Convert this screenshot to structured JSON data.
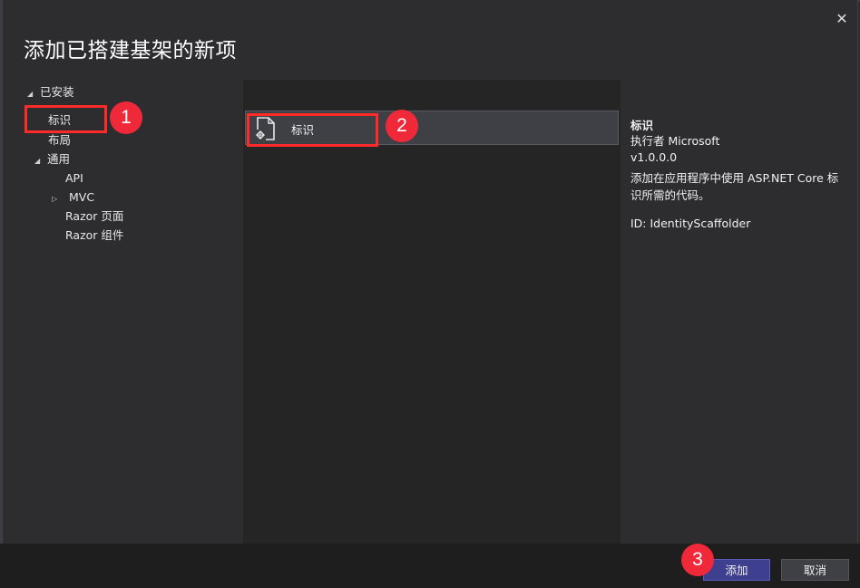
{
  "dialog": {
    "title": "添加已搭建基架的新项",
    "close_glyph": "✕"
  },
  "tree": {
    "root_label": "已安装",
    "items": [
      {
        "label": "标识"
      },
      {
        "label": "布局"
      },
      {
        "label": "通用"
      },
      {
        "label": "API"
      },
      {
        "label": "MVC"
      },
      {
        "label": "Razor 页面"
      },
      {
        "label": "Razor 组件"
      }
    ]
  },
  "list": {
    "items": [
      {
        "label": "标识",
        "icon": "scaffold-item-icon"
      }
    ]
  },
  "details": {
    "name": "标识",
    "author": "执行者 Microsoft",
    "version": "v1.0.0.0",
    "description": "添加在应用程序中使用 ASP.NET Core 标识所需的代码。",
    "id": "ID: IdentityScaffolder"
  },
  "buttons": {
    "add_label": "添加",
    "cancel_label": "取消"
  },
  "annotations": {
    "badge_1": "1",
    "badge_2": "2",
    "badge_3": "3",
    "highlight_color": "#ff2a2a",
    "badge_color": "#f0293a"
  }
}
